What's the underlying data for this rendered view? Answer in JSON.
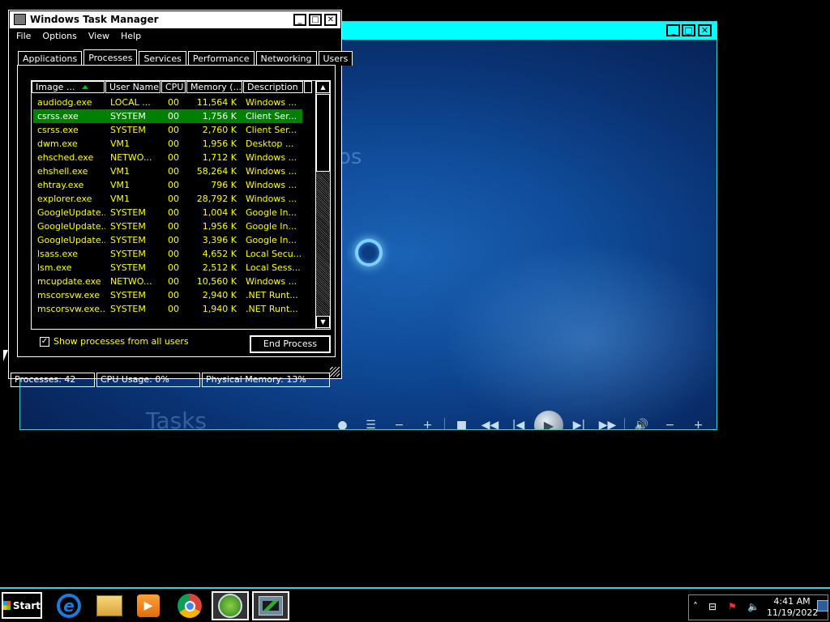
{
  "media_center": {
    "background_text": "os",
    "tasks_label": "Tasks",
    "window_buttons": {
      "minimize": "_",
      "maximize": "□",
      "close": "✕"
    },
    "controls": [
      "●",
      "☰",
      "−",
      "+",
      "■",
      "◀◀",
      "|◀",
      "▶",
      "▶|",
      "▶▶",
      "🔊",
      "−",
      "+"
    ]
  },
  "task_manager": {
    "title": "Windows Task Manager",
    "window_buttons": {
      "minimize": "_",
      "maximize": "□",
      "close": "✕"
    },
    "menu": [
      "File",
      "Options",
      "View",
      "Help"
    ],
    "tabs": [
      {
        "label": "Applications",
        "active": false
      },
      {
        "label": "Processes",
        "active": true
      },
      {
        "label": "Services",
        "active": false
      },
      {
        "label": "Performance",
        "active": false
      },
      {
        "label": "Networking",
        "active": false
      },
      {
        "label": "Users",
        "active": false
      }
    ],
    "columns": [
      "Image ...",
      "User Name",
      "CPU",
      "Memory (...",
      "Description"
    ],
    "processes": [
      {
        "name": "audiodg.exe",
        "user": "LOCAL ...",
        "cpu": "00",
        "memory": "11,564 K",
        "description": "Windows ..."
      },
      {
        "name": "csrss.exe",
        "user": "SYSTEM",
        "cpu": "00",
        "memory": "1,756 K",
        "description": "Client Ser...",
        "selected": true
      },
      {
        "name": "csrss.exe",
        "user": "SYSTEM",
        "cpu": "00",
        "memory": "2,760 K",
        "description": "Client Ser..."
      },
      {
        "name": "dwm.exe",
        "user": "VM1",
        "cpu": "00",
        "memory": "1,956 K",
        "description": "Desktop ..."
      },
      {
        "name": "ehsched.exe",
        "user": "NETWO...",
        "cpu": "00",
        "memory": "1,712 K",
        "description": "Windows ..."
      },
      {
        "name": "ehshell.exe",
        "user": "VM1",
        "cpu": "00",
        "memory": "58,264 K",
        "description": "Windows ..."
      },
      {
        "name": "ehtray.exe",
        "user": "VM1",
        "cpu": "00",
        "memory": "796 K",
        "description": "Windows ..."
      },
      {
        "name": "explorer.exe",
        "user": "VM1",
        "cpu": "00",
        "memory": "28,792 K",
        "description": "Windows ..."
      },
      {
        "name": "GoogleUpdate...",
        "user": "SYSTEM",
        "cpu": "00",
        "memory": "1,004 K",
        "description": "Google In..."
      },
      {
        "name": "GoogleUpdate...",
        "user": "SYSTEM",
        "cpu": "00",
        "memory": "1,956 K",
        "description": "Google In..."
      },
      {
        "name": "GoogleUpdate...",
        "user": "SYSTEM",
        "cpu": "00",
        "memory": "3,396 K",
        "description": "Google In..."
      },
      {
        "name": "lsass.exe",
        "user": "SYSTEM",
        "cpu": "00",
        "memory": "4,652 K",
        "description": "Local Secu..."
      },
      {
        "name": "lsm.exe",
        "user": "SYSTEM",
        "cpu": "00",
        "memory": "2,512 K",
        "description": "Local Sess..."
      },
      {
        "name": "mcupdate.exe",
        "user": "NETWO...",
        "cpu": "00",
        "memory": "10,560 K",
        "description": "Windows ..."
      },
      {
        "name": "mscorsvw.exe",
        "user": "SYSTEM",
        "cpu": "00",
        "memory": "2,940 K",
        "description": ".NET Runt..."
      },
      {
        "name": "mscorsvw.exe...",
        "user": "SYSTEM",
        "cpu": "00",
        "memory": "1,940 K",
        "description": ".NET Runt..."
      }
    ],
    "show_all_label": "Show processes from all users",
    "show_all_checked": "✓",
    "end_process_label": "End Process",
    "status": {
      "processes": "Processes: 42",
      "cpu": "CPU Usage: 0%",
      "memory": "Physical Memory: 13%"
    }
  },
  "taskbar": {
    "start_label": "Start",
    "apps": [
      {
        "name": "Internet Explorer",
        "icon": "ie-icon"
      },
      {
        "name": "Windows Explorer",
        "icon": "folder-icon"
      },
      {
        "name": "Windows Media Player",
        "icon": "media-player-icon"
      },
      {
        "name": "Google Chrome",
        "icon": "chrome-icon"
      },
      {
        "name": "Windows Media Center",
        "icon": "media-center-icon",
        "active": true
      },
      {
        "name": "Windows Task Manager",
        "icon": "task-manager-icon",
        "active": true
      }
    ],
    "clock_time": "4:41 AM",
    "clock_date": "11/19/2022"
  },
  "colors": {
    "selected_row": "#008000",
    "list_text": "#ffff00",
    "media_title_bar": "#00ffff"
  }
}
